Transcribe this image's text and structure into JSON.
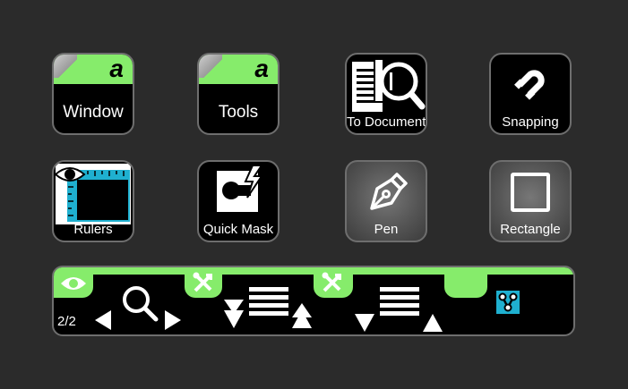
{
  "keys": [
    {
      "label": "Window",
      "icon": "app-logo-icon"
    },
    {
      "label": "Tools",
      "icon": "app-logo-icon"
    },
    {
      "label": "To Document",
      "icon": "zoom-to-document-icon"
    },
    {
      "label": "Snapping",
      "icon": "magnet-icon"
    },
    {
      "label": "Rulers",
      "icon": "rulers-icon"
    },
    {
      "label": "Quick Mask",
      "icon": "quick-mask-icon"
    },
    {
      "label": "Pen",
      "icon": "pen-nib-icon"
    },
    {
      "label": "Rectangle",
      "icon": "rectangle-icon"
    }
  ],
  "bar": {
    "page_indicator": "2/2",
    "icons": [
      "eye-icon",
      "zoom-icon",
      "tools-icon",
      "layer-order-icon",
      "tools-icon",
      "layer-order-icon",
      "node-graph-icon"
    ]
  },
  "colors": {
    "background": "#2b2b2b",
    "accent_green": "#86ec6b",
    "key_border": "#6e6e6e",
    "key_background": "#000000",
    "teal_icon": "#1fb0d0"
  }
}
